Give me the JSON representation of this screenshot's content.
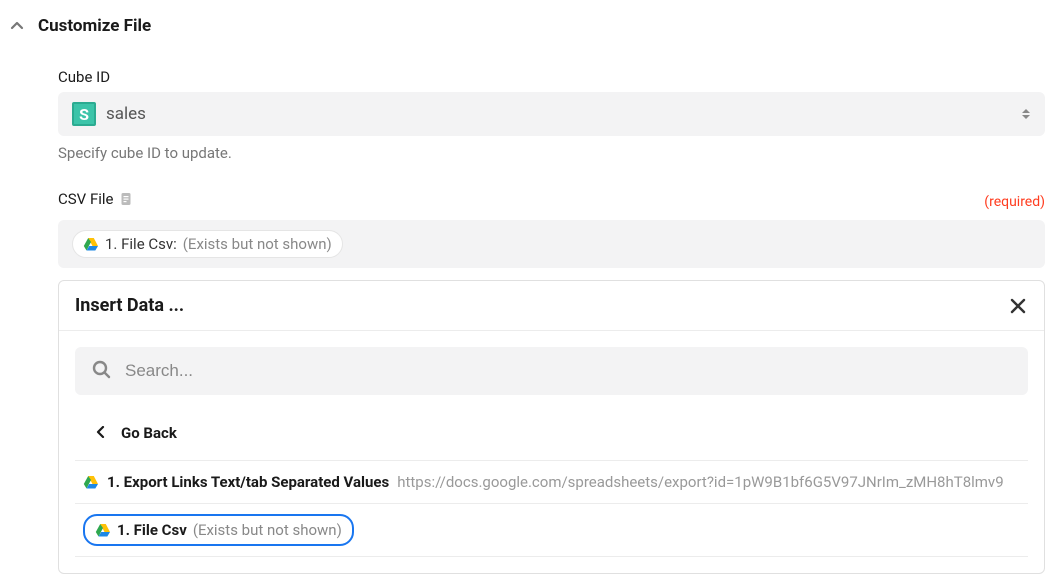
{
  "section": {
    "title": "Customize File"
  },
  "cube": {
    "label": "Cube ID",
    "value": "sales",
    "helper": "Specify cube ID to update."
  },
  "csv": {
    "label": "CSV File",
    "required_text": "(required)",
    "chip_prefix": "1. File Csv:",
    "chip_suffix": "(Exists but not shown)"
  },
  "modal": {
    "title": "Insert Data ...",
    "search_placeholder": "Search...",
    "go_back": "Go Back",
    "results": [
      {
        "label": "1. Export Links Text/tab Separated Values",
        "url": "https://docs.google.com/spreadsheets/export?id=1pW9B1bf6G5V97JNrIm_zMH8hT8lmv9"
      }
    ],
    "selected_chip": {
      "label": "1. File Csv",
      "suffix": "(Exists but not shown)"
    }
  }
}
